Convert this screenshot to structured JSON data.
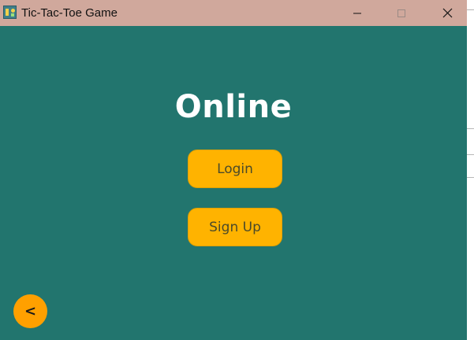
{
  "window": {
    "title": "Tic-Tac-Toe Game",
    "app_icon": "tic-tac-toe-app-icon",
    "controls": {
      "minimize_icon": "minimize-icon",
      "maximize_icon": "maximize-icon",
      "close_icon": "close-icon"
    }
  },
  "main": {
    "heading": "Online",
    "login_label": "Login",
    "signup_label": "Sign Up",
    "back_label": "<"
  },
  "colors": {
    "titlebar": "#d0a89c",
    "background": "#22756e",
    "button": "#ffb300",
    "back_button": "#ffa000",
    "heading_text": "#ffffff"
  }
}
